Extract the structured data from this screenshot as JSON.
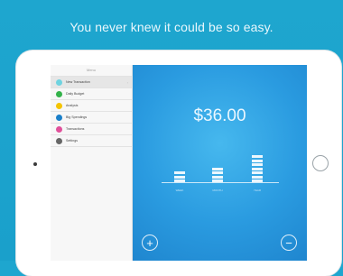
{
  "headline": "You never knew it could be so easy.",
  "sidebar": {
    "title": "Menu",
    "items": [
      {
        "label": "New Transaction",
        "color": "#6fd3e0",
        "active": true
      },
      {
        "label": "Daily Budget",
        "color": "#33b24a"
      },
      {
        "label": "Analysis",
        "color": "#f4c400"
      },
      {
        "label": "Big Spendings",
        "color": "#1a7fc9"
      },
      {
        "label": "Transactions",
        "color": "#e0509a"
      },
      {
        "label": "Settings",
        "color": "#666666"
      }
    ]
  },
  "main": {
    "amount": "$36.00",
    "bars": [
      {
        "label": "WEEK",
        "segments": 3
      },
      {
        "label": "MONTH",
        "segments": 4
      },
      {
        "label": "YEAR",
        "segments": 7
      }
    ],
    "add_symbol": "+",
    "subtract_symbol": "−"
  },
  "colors": {
    "background": "#1ea6cf",
    "panel": "#2a9be0"
  }
}
